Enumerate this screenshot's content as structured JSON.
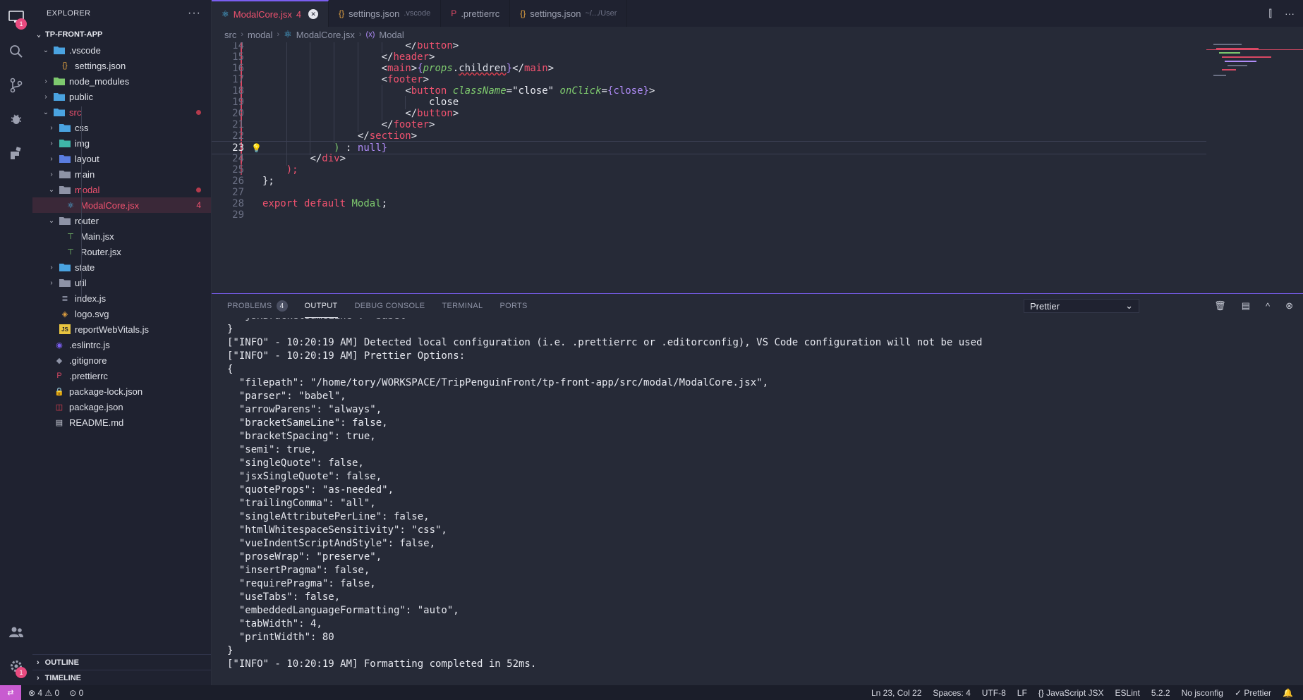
{
  "colors": {
    "accent": "#7a5ef0",
    "error": "#f0526f",
    "background": "#262a37",
    "sidebar": "#1f2230"
  },
  "activity_bar": {
    "items": [
      "explorer-icon",
      "search-icon",
      "source-control-icon",
      "debug-icon",
      "extensions-icon"
    ],
    "explorer_badge": "1",
    "accounts_icon": "accounts-icon",
    "settings_badge": "1"
  },
  "sidebar": {
    "title": "EXPLORER",
    "more": "···",
    "project": "TP-FRONT-APP",
    "tree": [
      {
        "label": ".vscode",
        "depth": 1,
        "chev": "open",
        "icon": "folder-vscode-icon",
        "color": "#4aa3e0"
      },
      {
        "label": "settings.json",
        "depth": 2,
        "chev": "",
        "icon": "json-icon",
        "color": "#e0a040"
      },
      {
        "label": "node_modules",
        "depth": 1,
        "chev": "closed",
        "icon": "folder-node-icon",
        "color": "#7ec96e"
      },
      {
        "label": "public",
        "depth": 1,
        "chev": "closed",
        "icon": "folder-public-icon",
        "color": "#4aa3e0"
      },
      {
        "label": "src",
        "depth": 1,
        "chev": "open",
        "icon": "folder-src-icon",
        "color": "#4aa3e0",
        "state": "red",
        "dot": true
      },
      {
        "label": "css",
        "depth": 2,
        "chev": "closed",
        "icon": "folder-css-icon",
        "color": "#4aa3e0"
      },
      {
        "label": "img",
        "depth": 2,
        "chev": "closed",
        "icon": "folder-img-icon",
        "color": "#3fb6a8"
      },
      {
        "label": "layout",
        "depth": 2,
        "chev": "closed",
        "icon": "folder-layout-icon",
        "color": "#5a7de0"
      },
      {
        "label": "main",
        "depth": 2,
        "chev": "closed",
        "icon": "folder-icon",
        "color": "#8e93a6"
      },
      {
        "label": "modal",
        "depth": 2,
        "chev": "open",
        "icon": "folder-open-icon",
        "color": "#8e93a6",
        "state": "red",
        "dot": true
      },
      {
        "label": "ModalCore.jsx",
        "depth": 3,
        "chev": "",
        "icon": "react-icon",
        "color": "#4fc3f7",
        "state": "red",
        "selected": true,
        "count": "4"
      },
      {
        "label": "router",
        "depth": 2,
        "chev": "open",
        "icon": "folder-router-icon",
        "color": "#8e93a6"
      },
      {
        "label": "Main.jsx",
        "depth": 3,
        "chev": "",
        "icon": "route-icon",
        "color": "#7ec96e"
      },
      {
        "label": "Router.jsx",
        "depth": 3,
        "chev": "",
        "icon": "route-icon",
        "color": "#7ec96e"
      },
      {
        "label": "state",
        "depth": 2,
        "chev": "closed",
        "icon": "folder-state-icon",
        "color": "#4aa3e0"
      },
      {
        "label": "util",
        "depth": 2,
        "chev": "closed",
        "icon": "folder-util-icon",
        "color": "#8e93a6"
      },
      {
        "label": "index.js",
        "depth": 2,
        "chev": "",
        "icon": "list-icon",
        "color": "#8e93a6"
      },
      {
        "label": "logo.svg",
        "depth": 2,
        "chev": "",
        "icon": "svg-icon",
        "color": "#e0a040"
      },
      {
        "label": "reportWebVitals.js",
        "depth": 2,
        "chev": "",
        "icon": "js-icon",
        "color": "#e8c440"
      },
      {
        "label": ".eslintrc.js",
        "depth": 1,
        "chev": "",
        "icon": "eslint-icon",
        "color": "#7a5ef0"
      },
      {
        "label": ".gitignore",
        "depth": 1,
        "chev": "",
        "icon": "git-icon",
        "color": "#8e93a6"
      },
      {
        "label": ".prettierrc",
        "depth": 1,
        "chev": "",
        "icon": "prettier-icon",
        "color": "#d94864"
      },
      {
        "label": "package-lock.json",
        "depth": 1,
        "chev": "",
        "icon": "lock-icon",
        "color": "#e04050"
      },
      {
        "label": "package.json",
        "depth": 1,
        "chev": "",
        "icon": "npm-icon",
        "color": "#e04050"
      },
      {
        "label": "README.md",
        "depth": 1,
        "chev": "",
        "icon": "markdown-icon",
        "color": "#c8cbd6"
      }
    ],
    "outline_label": "OUTLINE",
    "timeline_label": "TIMELINE"
  },
  "tabs": [
    {
      "label": "ModalCore.jsx",
      "badge": "4",
      "desc": "",
      "icon": "react-icon",
      "active": true
    },
    {
      "label": "settings.json",
      "badge": "",
      "desc": ".vscode",
      "icon": "json-icon",
      "active": false
    },
    {
      "label": ".prettierrc",
      "badge": "",
      "desc": "",
      "icon": "prettier-icon",
      "active": false
    },
    {
      "label": "settings.json",
      "badge": "",
      "desc": "~/.../User",
      "icon": "json-icon",
      "active": false
    }
  ],
  "breadcrumb": [
    "src",
    "modal",
    "ModalCore.jsx",
    "Modal"
  ],
  "code": {
    "lines": [
      {
        "n": "14",
        "indent": 24,
        "html": "<span class=\"t-punc\">&lt;/</span><span class=\"t-tag\">button</span><span class=\"t-punc\">&gt;</span>"
      },
      {
        "n": "15",
        "indent": 20,
        "html": "<span class=\"t-punc\">&lt;/</span><span class=\"t-tag\">header</span><span class=\"t-punc\">&gt;</span>"
      },
      {
        "n": "16",
        "indent": 20,
        "html": "<span class=\"t-punc\">&lt;</span><span class=\"t-tag\">main</span><span class=\"t-punc\">&gt;</span><span class=\"t-br\">{</span><span class=\"t-attr\">props</span><span class=\"t-punc\">.</span><span class=\"t-err\">children</span><span class=\"t-br\">}</span><span class=\"t-punc\">&lt;/</span><span class=\"t-tag\">main</span><span class=\"t-punc\">&gt;</span>"
      },
      {
        "n": "17",
        "indent": 20,
        "html": "<span class=\"t-punc\">&lt;</span><span class=\"t-tag\">footer</span><span class=\"t-punc\">&gt;</span>"
      },
      {
        "n": "18",
        "indent": 24,
        "html": "<span class=\"t-punc\">&lt;</span><span class=\"t-tag\">button</span> <span class=\"t-attr\">className</span><span class=\"t-punc\">=</span><span class=\"t-str\">\"close\"</span> <span class=\"t-attr\">onClick</span><span class=\"t-punc\">=</span><span class=\"t-br\">{close}</span><span class=\"t-punc\">&gt;</span>"
      },
      {
        "n": "19",
        "indent": 28,
        "html": "<span class=\"t-str\">close</span>"
      },
      {
        "n": "20",
        "indent": 24,
        "html": "<span class=\"t-punc\">&lt;/</span><span class=\"t-tag\">button</span><span class=\"t-punc\">&gt;</span>"
      },
      {
        "n": "21",
        "indent": 20,
        "html": "<span class=\"t-punc\">&lt;/</span><span class=\"t-tag\">footer</span><span class=\"t-punc\">&gt;</span>"
      },
      {
        "n": "22",
        "indent": 16,
        "html": "<span class=\"t-punc\">&lt;/</span><span class=\"t-tag\">section</span><span class=\"t-punc\">&gt;</span>"
      },
      {
        "n": "23",
        "indent": 12,
        "html": "<span class=\"t-id\">)</span> <span class=\"t-punc\">:</span> <span class=\"t-br\">null}</span>",
        "current": true,
        "bulb": true
      },
      {
        "n": "24",
        "indent": 8,
        "html": "<span class=\"t-punc\">&lt;/</span><span class=\"t-tag\">div</span><span class=\"t-punc\">&gt;</span>"
      },
      {
        "n": "25",
        "indent": 4,
        "html": "<span class=\"t-kw\">);</span>"
      },
      {
        "n": "26",
        "indent": 0,
        "html": "<span class=\"t-punc\">};</span>"
      },
      {
        "n": "27",
        "indent": 0,
        "html": ""
      },
      {
        "n": "28",
        "indent": 0,
        "html": "<span class=\"t-kw\">export</span> <span class=\"t-kw\">default</span> <span class=\"t-id\">Modal</span><span class=\"t-punc\">;</span>"
      },
      {
        "n": "29",
        "indent": 0,
        "html": ""
      }
    ]
  },
  "panel": {
    "tabs": [
      {
        "label": "PROBLEMS",
        "badge": "4",
        "active": false
      },
      {
        "label": "OUTPUT",
        "badge": "",
        "active": true
      },
      {
        "label": "DEBUG CONSOLE",
        "badge": "",
        "active": false
      },
      {
        "label": "TERMINAL",
        "badge": "",
        "active": false
      },
      {
        "label": "PORTS",
        "badge": "",
        "active": false
      }
    ],
    "channel": "Prettier",
    "output_lines": [
      "  \"jsxBracketSameLine\": \"babel\"",
      "}",
      "[\"INFO\" - 10:20:19 AM] Detected local configuration (i.e. .prettierrc or .editorconfig), VS Code configuration will not be used",
      "[\"INFO\" - 10:20:19 AM] Prettier Options:",
      "{",
      "  \"filepath\": \"/home/tory/WORKSPACE/TripPenguinFront/tp-front-app/src/modal/ModalCore.jsx\",",
      "  \"parser\": \"babel\",",
      "  \"arrowParens\": \"always\",",
      "  \"bracketSameLine\": false,",
      "  \"bracketSpacing\": true,",
      "  \"semi\": true,",
      "  \"singleQuote\": false,",
      "  \"jsxSingleQuote\": false,",
      "  \"quoteProps\": \"as-needed\",",
      "  \"trailingComma\": \"all\",",
      "  \"singleAttributePerLine\": false,",
      "  \"htmlWhitespaceSensitivity\": \"css\",",
      "  \"vueIndentScriptAndStyle\": false,",
      "  \"proseWrap\": \"preserve\",",
      "  \"insertPragma\": false,",
      "  \"requirePragma\": false,",
      "  \"useTabs\": false,",
      "  \"embeddedLanguageFormatting\": \"auto\",",
      "  \"tabWidth\": 4,",
      "  \"printWidth\": 80",
      "}",
      "[\"INFO\" - 10:20:19 AM] Formatting completed in 52ms."
    ]
  },
  "status": {
    "errors": "4",
    "warnings": "0",
    "ports": "0",
    "position": "Ln 23, Col 22",
    "spaces": "Spaces: 4",
    "encoding": "UTF-8",
    "eol": "LF",
    "language": "JavaScript JSX",
    "linter": "ESLint",
    "version": "5.2.2",
    "jsconfig": "No jsconfig",
    "formatter": "Prettier"
  }
}
